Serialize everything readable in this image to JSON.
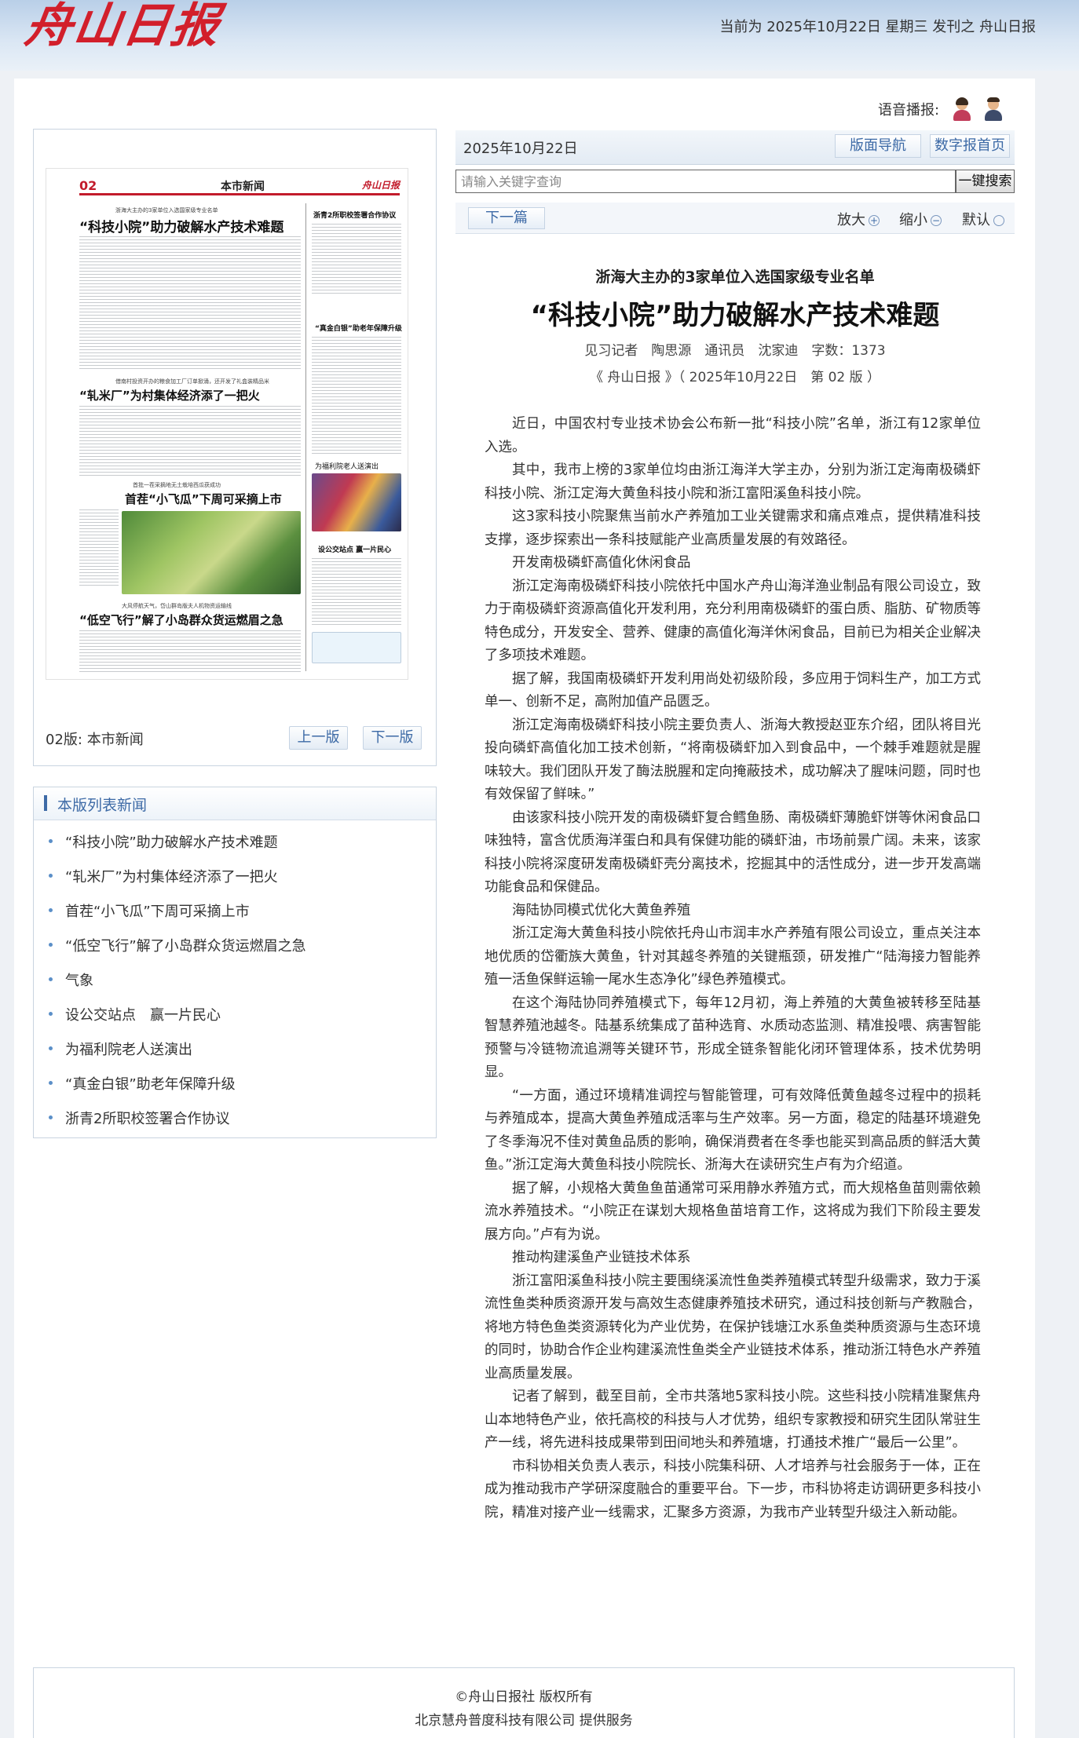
{
  "header": {
    "logo_text": "舟山日报",
    "publish_info": "当前为 2025年10月22日 星期三 发刊之 舟山日报"
  },
  "voice": {
    "label": "语音播报:"
  },
  "paper": {
    "thumb": {
      "page_num": "02",
      "section": "本市新闻",
      "brand": "舟山日报",
      "headlines": {
        "h1_sub": "浙海大主办的3家单位入选国家级专业名单",
        "h1": "“科技小院”助力破解水产技术难题",
        "h2_sub": "借南村投资开办的粮食加工厂订单掀涌，还开发了礼盒装精品米",
        "h2": "“轧米厂”为村集体经济添了一把火",
        "h3_sub": "首批一茬采摘地无土栽培西瓜获成功",
        "h3": "首茬“小飞瓜”下周可采摘上市",
        "h4_sub": "大风停航天气，岱山群岛版夫人机物资运输线",
        "h4": "“低空飞行”解了小岛群众货运燃眉之急",
        "r1": "浙青2所职校签署合作协议",
        "r2": "“真金白银”助老年保障升级",
        "r3": "为福利院老人送演出",
        "r4": "设公交站点 赢一片民心"
      }
    },
    "footer_label": "02版: 本市新闻",
    "prev_btn": "上一版",
    "next_btn": "下一版"
  },
  "news_list": {
    "title": "本版列表新闻",
    "items": [
      "“科技小院”助力破解水产技术难题",
      "“轧米厂”为村集体经济添了一把火",
      "首茬“小飞瓜”下周可采摘上市",
      "“低空飞行”解了小岛群众货运燃眉之急",
      "气象",
      "设公交站点　赢一片民心",
      "为福利院老人送演出",
      "“真金白银”助老年保障升级",
      "浙青2所职校签署合作协议"
    ]
  },
  "toolbar": {
    "date": "2025年10月22日",
    "nav_btn": "版面导航",
    "home_btn": "数字报首页",
    "search_placeholder": "请输入关键字查询",
    "search_btn": "一键搜索",
    "next_article": "下一篇",
    "zoom_in": "放大",
    "zoom_out": "缩小",
    "zoom_default": "默认"
  },
  "article": {
    "subtitle": "浙海大主办的3家单位入选国家级专业名单",
    "title": "“科技小院”助力破解水产技术难题",
    "meta": "见习记者　陶思源　通讯员　沈家迪　字数：1373",
    "source": "《 舟山日报 》（ 2025年10月22日　第 02 版 ）",
    "paragraphs": [
      "近日，中国农村专业技术协会公布新一批“科技小院”名单，浙江有12家单位入选。",
      "其中，我市上榜的3家单位均由浙江海洋大学主办，分别为浙江定海南极磷虾科技小院、浙江定海大黄鱼科技小院和浙江富阳溪鱼科技小院。",
      "这3家科技小院聚焦当前水产养殖加工业关键需求和痛点难点，提供精准科技支撑，逐步探索出一条科技赋能产业高质量发展的有效路径。",
      "开发南极磷虾高值化休闲食品",
      "浙江定海南极磷虾科技小院依托中国水产舟山海洋渔业制品有限公司设立，致力于南极磷虾资源高值化开发利用，充分利用南极磷虾的蛋白质、脂肪、矿物质等特色成分，开发安全、营养、健康的高值化海洋休闲食品，目前已为相关企业解决了多项技术难题。",
      "据了解，我国南极磷虾开发利用尚处初级阶段，多应用于饲料生产，加工方式单一、创新不足，高附加值产品匮乏。",
      "浙江定海南极磷虾科技小院主要负责人、浙海大教授赵亚东介绍，团队将目光投向磷虾高值化加工技术创新，“将南极磷虾加入到食品中，一个棘手难题就是腥味较大。我们团队开发了酶法脱腥和定向掩蔽技术，成功解决了腥味问题，同时也有效保留了鲜味。”",
      "由该家科技小院开发的南极磷虾复合鳕鱼肠、南极磷虾薄脆虾饼等休闲食品口味独特，富含优质海洋蛋白和具有保健功能的磷虾油，市场前景广阔。未来，该家科技小院将深度研发南极磷虾壳分离技术，挖掘其中的活性成分，进一步开发高端功能食品和保健品。",
      "海陆协同模式优化大黄鱼养殖",
      "浙江定海大黄鱼科技小院依托舟山市润丰水产养殖有限公司设立，重点关注本地优质的岱衢族大黄鱼，针对其越冬养殖的关键瓶颈，研发推广“陆海接力智能养殖一活鱼保鲜运输一尾水生态净化”绿色养殖模式。",
      "在这个海陆协同养殖模式下，每年12月初，海上养殖的大黄鱼被转移至陆基智慧养殖池越冬。陆基系统集成了苗种选育、水质动态监测、精准投喂、病害智能预警与冷链物流追溯等关键环节，形成全链条智能化闭环管理体系，技术优势明显。",
      "“一方面，通过环境精准调控与智能管理，可有效降低黄鱼越冬过程中的损耗与养殖成本，提高大黄鱼养殖成活率与生产效率。另一方面，稳定的陆基环境避免了冬季海况不佳对黄鱼品质的影响，确保消费者在冬季也能买到高品质的鲜活大黄鱼。”浙江定海大黄鱼科技小院院长、浙海大在读研究生卢有为介绍道。",
      "据了解，小规格大黄鱼鱼苗通常可采用静水养殖方式，而大规格鱼苗则需依赖流水养殖技术。“小院正在谋划大规格鱼苗培育工作，这将成为我们下阶段主要发展方向。”卢有为说。",
      "推动构建溪鱼产业链技术体系",
      "浙江富阳溪鱼科技小院主要围绕溪流性鱼类养殖模式转型升级需求，致力于溪流性鱼类种质资源开发与高效生态健康养殖技术研究，通过科技创新与产教融合，将地方特色鱼类资源转化为产业优势，在保护钱塘江水系鱼类种质资源与生态环境的同时，协助合作企业构建溪流性鱼类全产业链技术体系，推动浙江特色水产养殖业高质量发展。",
      "记者了解到，截至目前，全市共落地5家科技小院。这些科技小院精准聚焦舟山本地特色产业，依托高校的科技与人才优势，组织专家教授和研究生团队常驻生产一线，将先进科技成果带到田间地头和养殖塘，打通技术推广“最后一公里”。",
      "市科协相关负责人表示，科技小院集科研、人才培养与社会服务于一体，正在成为推动我市产学研深度融合的重要平台。下一步，市科协将走访调研更多科技小院，精准对接产业一线需求，汇聚多方资源，为我市产业转型升级注入新动能。"
    ]
  },
  "footer": {
    "copyright": "©舟山日报社 版权所有",
    "provider": "北京慧舟普度科技有限公司 提供服务"
  },
  "colors": {
    "accent": "#3d6aa6",
    "brand_red": "#d21f2b"
  }
}
